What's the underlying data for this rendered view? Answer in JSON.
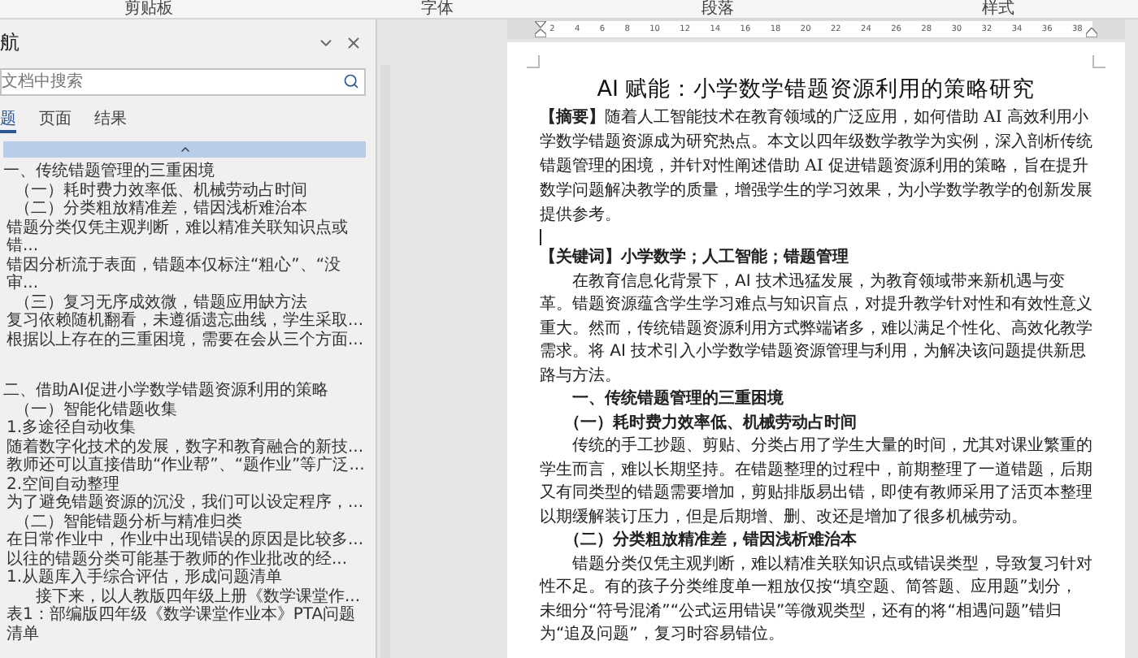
{
  "ribbon": {
    "groups": [
      "剪贴板",
      "字体",
      "段落",
      "样式"
    ]
  },
  "navigation": {
    "title": "航",
    "search": {
      "placeholder": "文档中搜索"
    },
    "tabs": [
      {
        "label": "题",
        "selected": true
      },
      {
        "label": "页面",
        "selected": false
      },
      {
        "label": "结果",
        "selected": false
      }
    ],
    "sections": [
      {
        "text": "一、传统错题管理的三重困境",
        "children": [
          {
            "text": "（一）耗时费力效率低、机械劳动占时间"
          },
          {
            "text": "（二）分类粗放精准差，错因浅析难治本",
            "children": [
              {
                "text": "错题分类仅凭主观判断，难以精准关联知识点或错..."
              },
              {
                "text": "错因分析流于表面，错题本仅标注“粗心”、“没审..."
              }
            ]
          },
          {
            "text": "（三）复习无序成效微，错题应用缺方法",
            "children": [
              {
                "text": "复习依赖随机翻看，未遵循遗忘曲线，学生采取..."
              },
              {
                "text": "根据以上存在的三重困境，需要在会从三个方面..."
              }
            ]
          }
        ]
      },
      {
        "text": "二、借助AI促进小学数学错题资源利用的策略",
        "children": [
          {
            "text": "（一）智能化错题收集",
            "children": [
              {
                "text": "1.多途径自动收集"
              },
              {
                "text": "随着数字化技术的发展，数字和教育融合的新技..."
              },
              {
                "text": "教师还可以直接借助“作业帮”、“题作业”等广泛..."
              },
              {
                "text": "2.空间自动整理"
              },
              {
                "text": "为了避免错题资源的沉没，我们可以设定程序，..."
              }
            ]
          },
          {
            "text": "（二）智能错题分析与精准归类",
            "children": [
              {
                "text": "在日常作业中，作业中出现错误的原因是比较多..."
              },
              {
                "text": "以往的错题分类可能基于教师的作业批改的经..."
              },
              {
                "text": "1.从题库入手综合评估，形成问题清单",
                "children": [
                  {
                    "text": "接下来，以人教版四年级上册《数学课堂作..."
                  }
                ]
              },
              {
                "text": "表1：部编版四年级《数学课堂作业本》PTA问题清单"
              }
            ]
          }
        ]
      }
    ]
  },
  "ruler": {
    "ticks": [
      "2",
      "4",
      "6",
      "8",
      "10",
      "12",
      "14",
      "16",
      "18",
      "20",
      "22",
      "24",
      "26",
      "28",
      "30",
      "32",
      "34",
      "36",
      "38"
    ]
  },
  "document": {
    "title": "AI 赋能：小学数学错题资源利用的策略研究",
    "blocks": [
      {
        "kind": "abstract",
        "text": "**【摘要】**随着人工智能技术在教育领域的广泛应用，如何借助 AI 高效利用小学数学错题资源成为研究热点。本文以四年级数学教学为实例，深入剖析传统错题管理的困境，并针对性阐述借助 AI 促进错题资源利用的策略，旨在提升数学问题解决教学的质量，增强学生的学习效果，为小学数学教学的创新发展提供参考。"
      },
      {
        "kind": "keywords",
        "text": "【关键词】小学数学；人工智能；错题管理"
      },
      {
        "kind": "body",
        "text": "在教育信息化背景下，AI 技术迅猛发展，为教育领域带来新机遇与变革。错题资源蕴含学生学习难点与知识盲点，对提升教学针对性和有效性意义重大。然而，传统错题资源利用方式弊端诸多，难以满足个性化、高效化教学需求。将 AI 技术引入小学数学错题资源管理与利用，为解决该问题提供新思路与方法。"
      },
      {
        "kind": "heading1",
        "text": "一、传统错题管理的三重困境"
      },
      {
        "kind": "heading2",
        "text": "（一）耗时费力效率低、机械劳动占时间"
      },
      {
        "kind": "body",
        "text": "传统的手工抄题、剪贴、分类占用了学生大量的时间，尤其对课业繁重的学生而言，难以长期坚持。在错题整理的过程中，前期整理了一道错题，后期又有同类型的错题需要增加，剪贴排版易出错，即使有教师采用了活页本整理以期缓解装订压力，但是后期增、删、改还是增加了很多机械劳动。"
      },
      {
        "kind": "heading2",
        "text": "（二）分类粗放精准差，错因浅析难治本"
      },
      {
        "kind": "body",
        "text": "错题分类仅凭主观判断，难以精准关联知识点或错误类型，导致复习针对性不足。有的孩子分类维度单一粗放仅按“填空题、简答题、应用题”划分，未细分“符号混淆”“公式运用错误”等微观类型，还有的将“相遇问题”错归为“追及问题”，复习时容易错位。"
      }
    ]
  }
}
